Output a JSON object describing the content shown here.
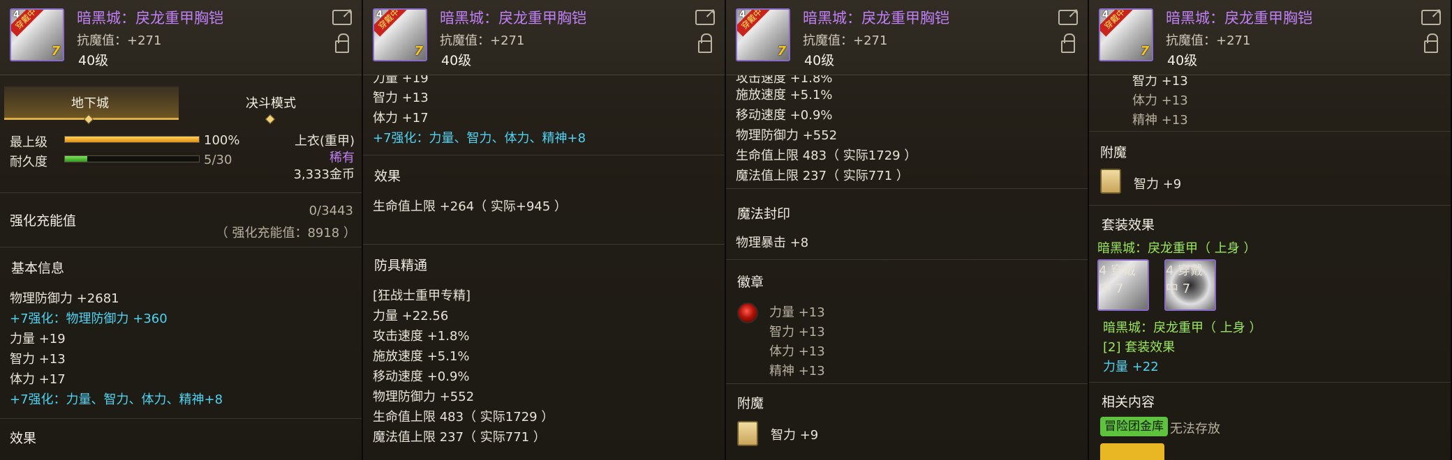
{
  "item": {
    "name": "暗黑城：戾龙重甲胸铠",
    "anti_magic": "抗魔值：+271",
    "level": "40级",
    "icon_badge": "穿戴中",
    "icon_num": "4",
    "icon_enhance": "7"
  },
  "p1": {
    "tab_dungeon": "地下城",
    "tab_duel": "决斗模式",
    "grade_label": "最上级",
    "grade_value": "100%",
    "grade_fill": 1.0,
    "durability_label": "耐久度",
    "durability_value": "5/30",
    "durability_fill": 0.1667,
    "slot_type": "上衣(重甲)",
    "rarity": "稀有",
    "price": "3,333金币",
    "charge_title": "强化充能值",
    "charge_value": "0/3443",
    "charge_detail": "（ 强化充能值：8918 ）",
    "basic_title": "基本信息",
    "basic": [
      {
        "text": "物理防御力 +2681",
        "cls": "w"
      },
      {
        "text": "+7强化：物理防御力 +360",
        "cls": "cyan"
      },
      {
        "text": "力量 +19",
        "cls": "w"
      },
      {
        "text": "智力 +13",
        "cls": "w"
      },
      {
        "text": "体力 +17",
        "cls": "w"
      },
      {
        "text": "+7强化：力量、智力、体力、精神+8",
        "cls": "cyan"
      }
    ],
    "effect_title": "效果"
  },
  "p2": {
    "partial_top": "力量 +19",
    "lines_top": [
      {
        "text": "智力 +13",
        "cls": "w"
      },
      {
        "text": "体力 +17",
        "cls": "w"
      },
      {
        "text": "+7强化：力量、智力、体力、精神+8",
        "cls": "cyan"
      }
    ],
    "effect_title": "效果",
    "effect_line": "生命值上限 +264（ 实际+945 ）",
    "mastery_title": "防具精通",
    "mastery_lines": [
      "[狂战士重甲专精]",
      "力量 +22.56",
      "攻击速度 +1.8%",
      "施放速度 +5.1%",
      "移动速度 +0.9%",
      "物理防御力 +552",
      "生命值上限 483（ 实际1729 ）",
      "魔法值上限 237（ 实际771 ）"
    ]
  },
  "p3": {
    "partial_top": "攻击速度 +1.8%",
    "lines_top": [
      "施放速度 +5.1%",
      "移动速度 +0.9%",
      "物理防御力 +552",
      "生命值上限 483（ 实际1729 ）",
      "魔法值上限 237（ 实际771 ）"
    ],
    "seal_title": "魔法封印",
    "seal_line": "物理暴击 +8",
    "emblem_title": "徽章",
    "emblem_lines": [
      "力量 +13",
      "智力 +13",
      "体力 +13",
      "精神 +13"
    ],
    "enchant_title": "附魔",
    "enchant_line": "智力 +9"
  },
  "p4": {
    "partial_top": "智力 +13",
    "lines_top": [
      "体力 +13",
      "精神 +13"
    ],
    "enchant_title": "附魔",
    "enchant_line": "智力 +9",
    "set_title": "套装效果",
    "set_name": "暗黑城：戾龙重甲（ 上身 ）",
    "set_sub": "暗黑城：戾龙重甲（ 上身 ）",
    "set_count": "[2] 套装效果",
    "set_bonus": "力量 +22",
    "related_title": "相关内容",
    "tag1": "冒险团金库",
    "tag1_text": "无法存放",
    "tag2": "",
    "tag2_text": ""
  }
}
